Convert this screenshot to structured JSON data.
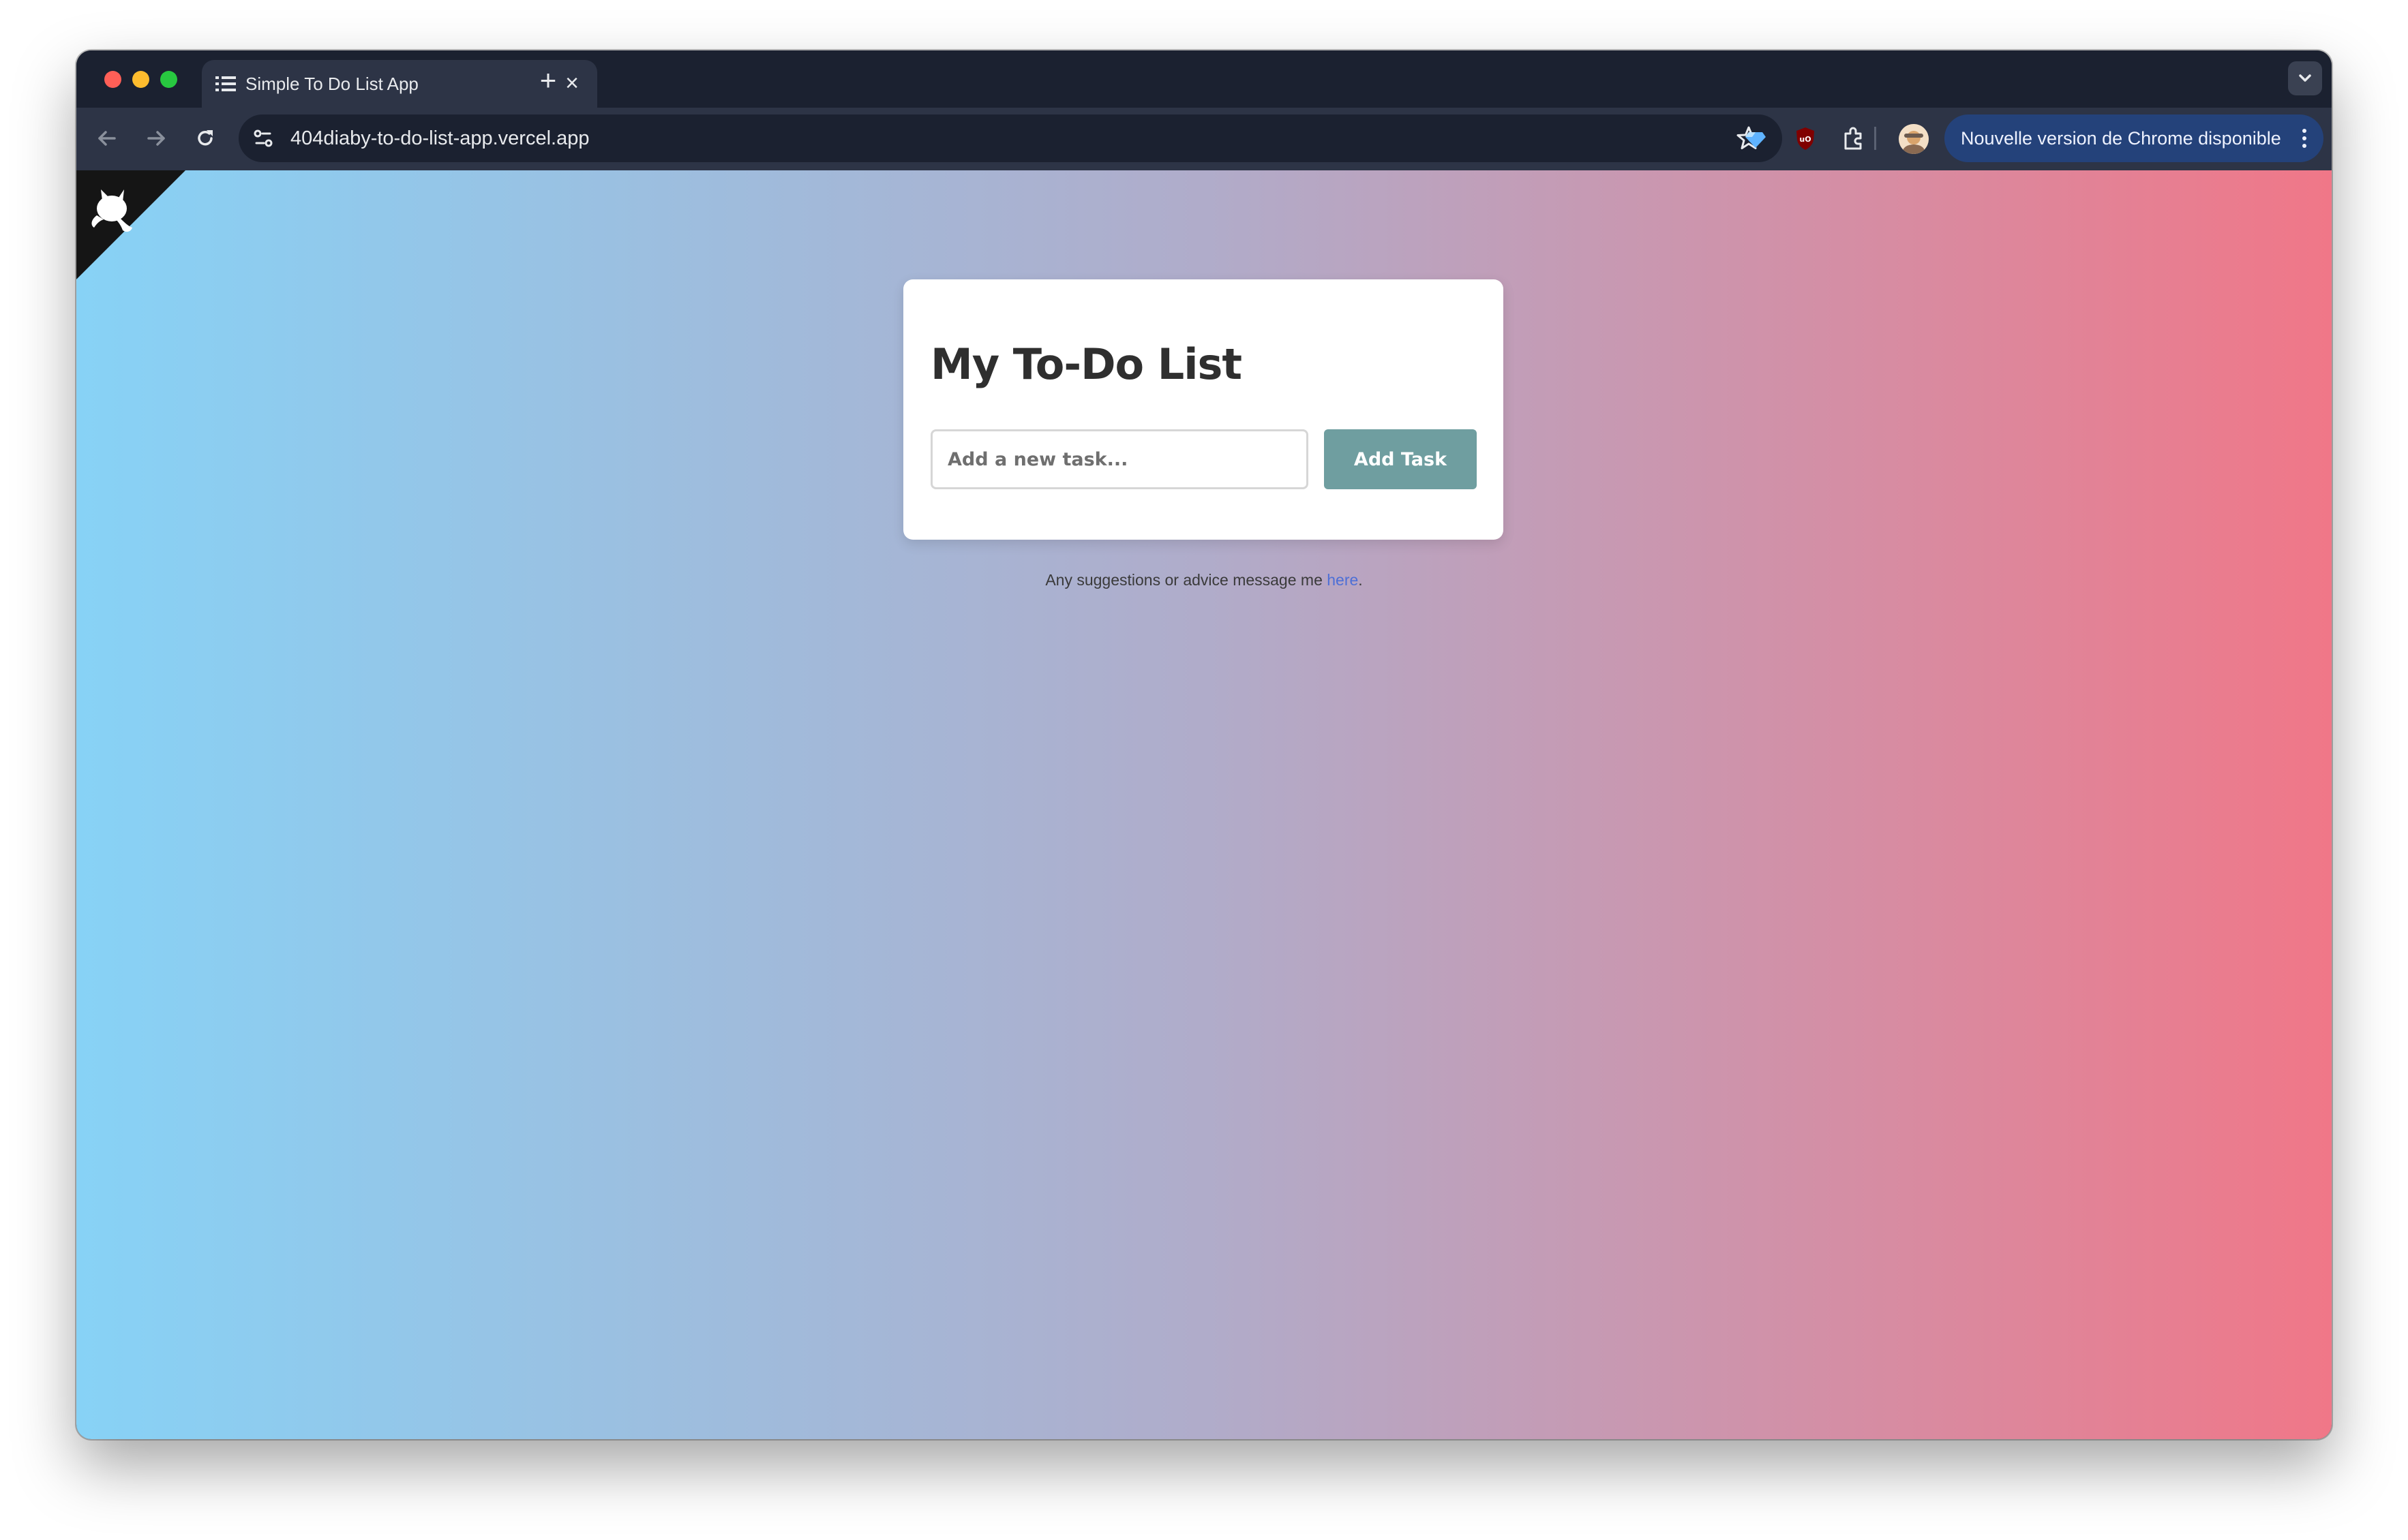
{
  "browser": {
    "tab": {
      "title": "Simple To Do List App",
      "close_glyph": "×",
      "favicon": "list-icon"
    },
    "new_tab_glyph": "+",
    "address_bar": {
      "url": "404diaby-to-do-list-app.vercel.app"
    },
    "update_banner": {
      "label": "Nouvelle version de Chrome disponible"
    },
    "icons": [
      "back-arrow-icon",
      "forward-arrow-icon",
      "reload-icon",
      "site-info-icon",
      "bookmark-star-icon",
      "gem-extension-icon",
      "ublock-origin-icon",
      "extensions-puzzle-icon",
      "profile-avatar",
      "kebab-menu-icon",
      "tab-search-icon"
    ]
  },
  "app": {
    "heading": "My To-Do List",
    "input": {
      "placeholder": "Add a new task...",
      "value": ""
    },
    "add_button_label": "Add Task",
    "footer": {
      "text": "Any suggestions or advice message me ",
      "link_text": "here",
      "suffix": "."
    },
    "gradient": {
      "start": "#87d2f6",
      "middle": "#b0acca",
      "end": "#f07788"
    },
    "button_color": "#6f9ea0"
  }
}
